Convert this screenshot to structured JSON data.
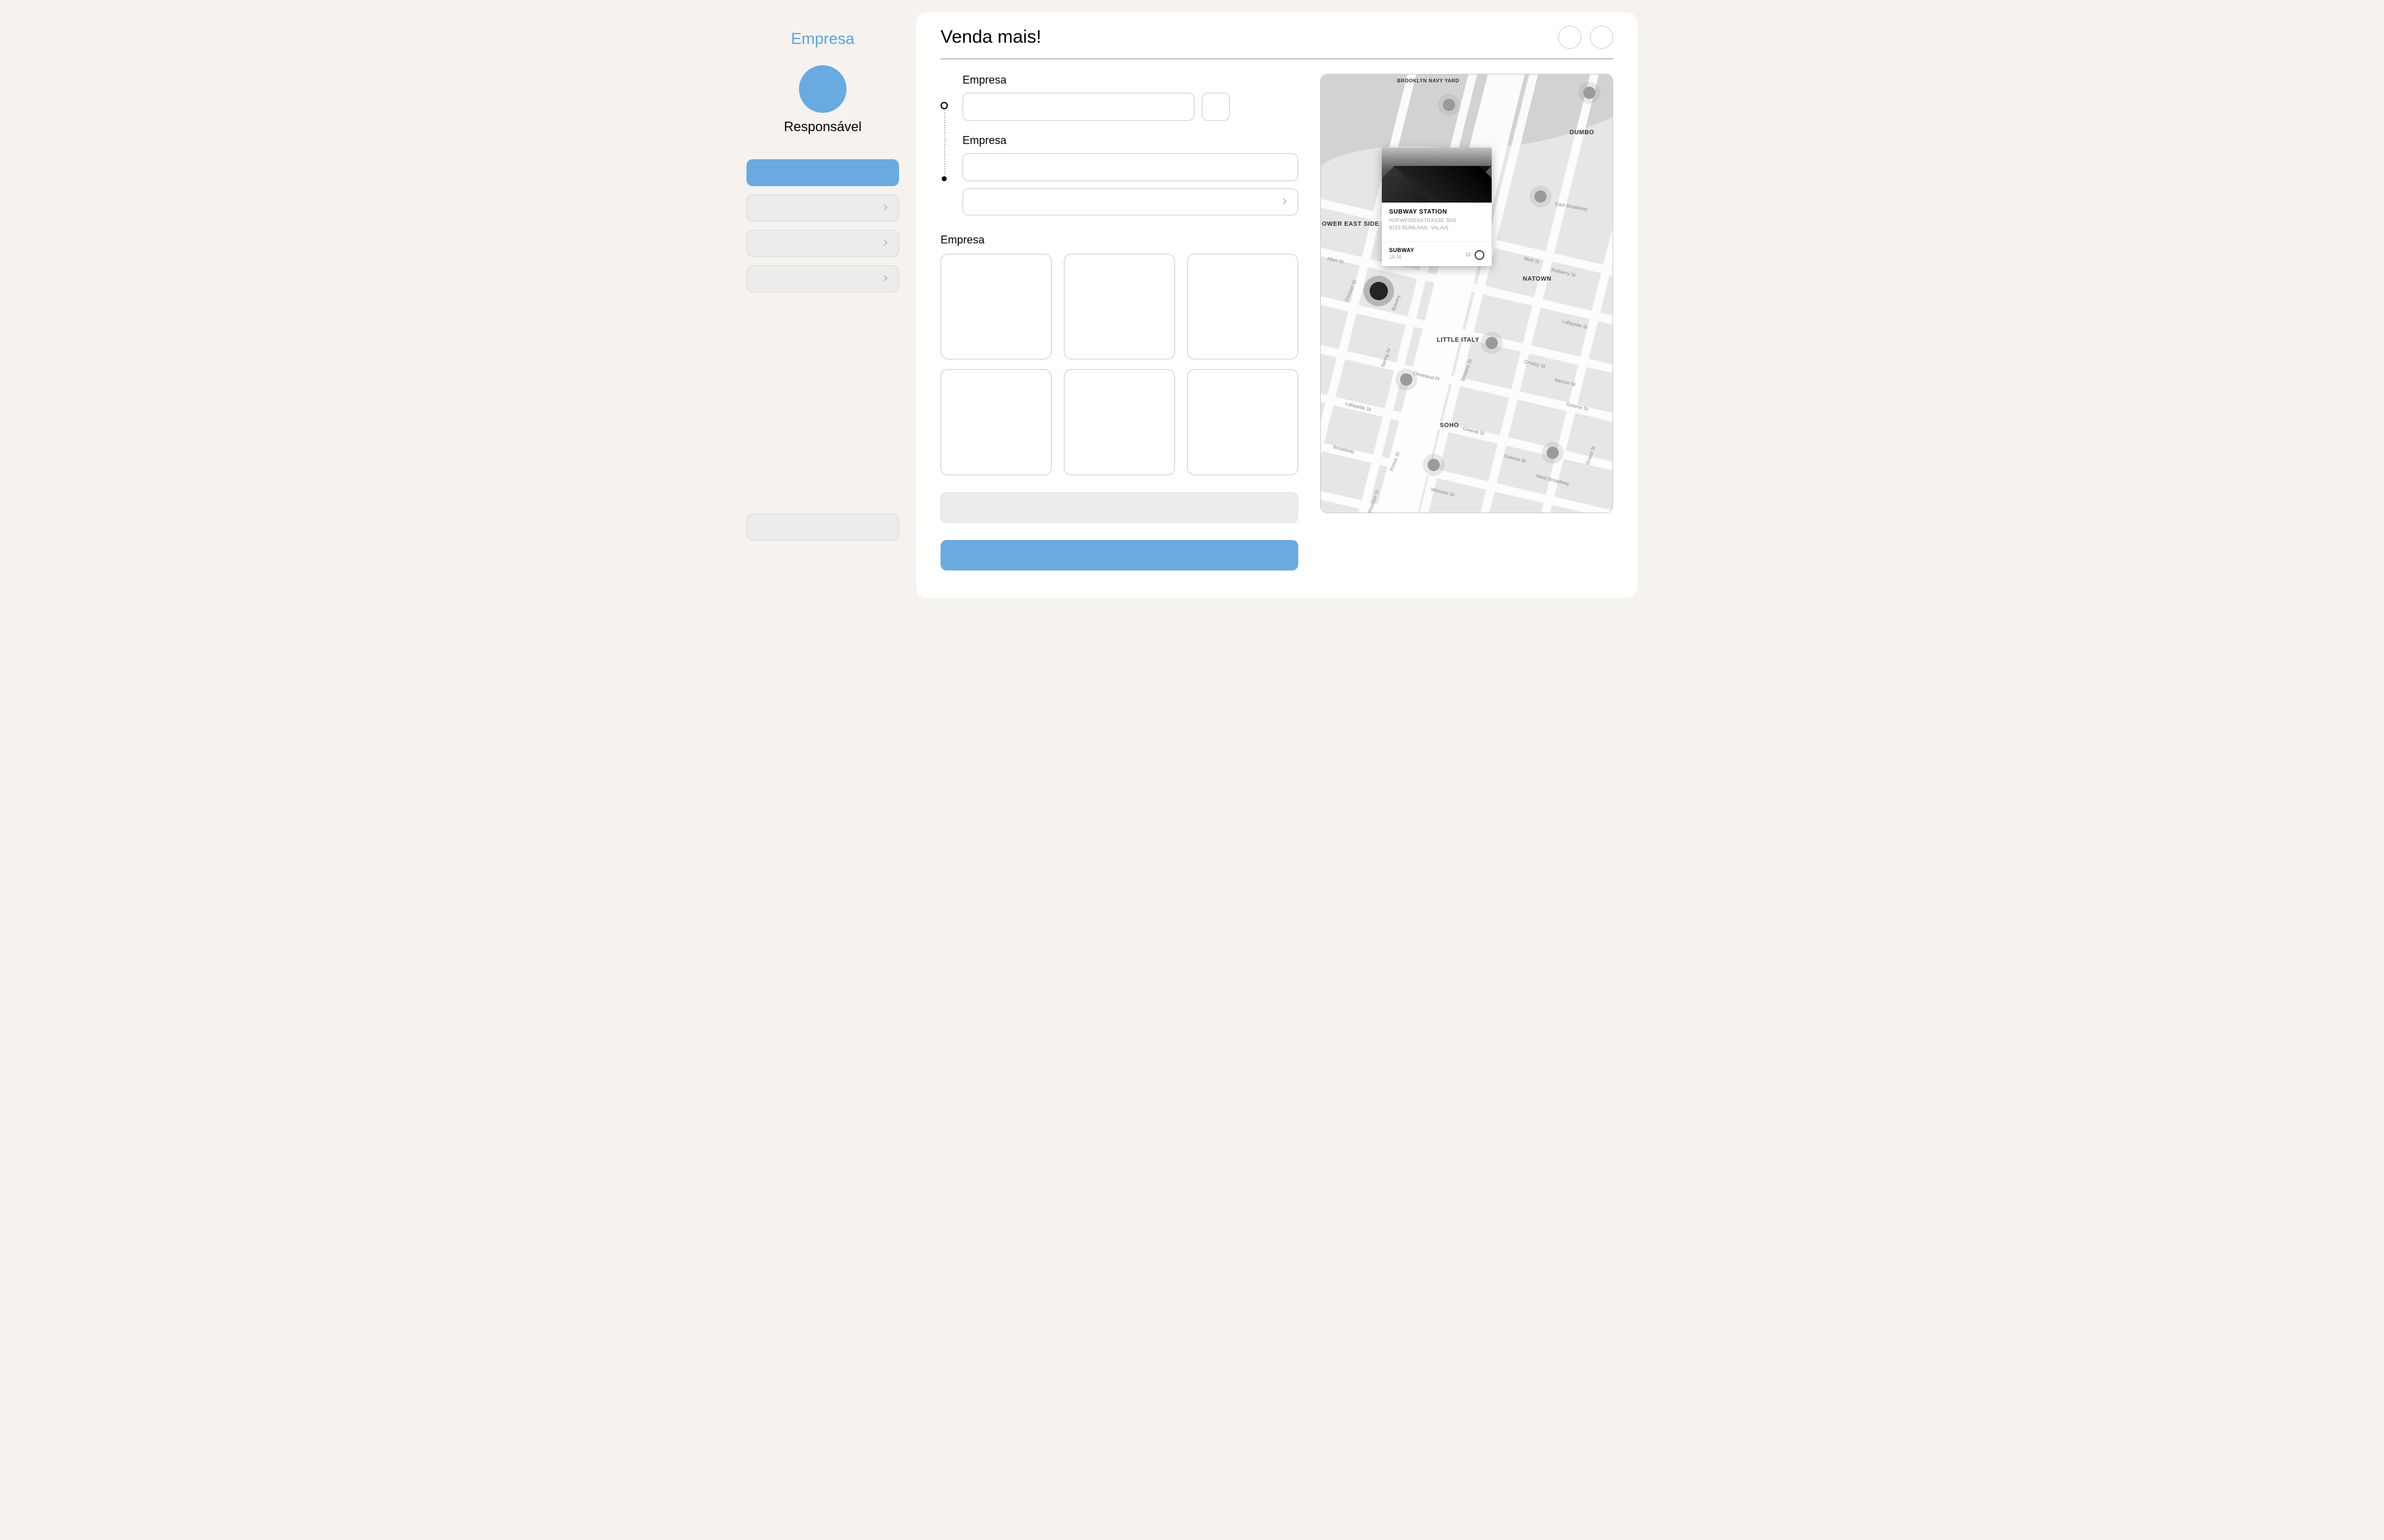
{
  "sidebar": {
    "title": "Empresa",
    "avatar_label": "Responsável",
    "primary_label": "",
    "nav_items": [
      {
        "label": ""
      },
      {
        "label": ""
      },
      {
        "label": ""
      }
    ],
    "bottom_label": ""
  },
  "main": {
    "title": "Venda mais!",
    "form_section1_label": "Empresa",
    "form_section2_label": "Empresa",
    "form_section3_label": "Empresa",
    "input1_value": "",
    "input2_value": "",
    "select_value": "",
    "grey_bar_label": "",
    "submit_label": ""
  },
  "map": {
    "districts": {
      "brooklyn_navy_yard": "BROOKLYN NAVY YARD",
      "dumbo": "DUMBO",
      "lower_east_side": "OWER EAST SIDE",
      "chinatown": "NATOWN",
      "little_italy": "LITTLE ITALY",
      "soho": "SOHO"
    },
    "streets": {
      "east_broadway": "East Broadway",
      "allen": "Allen St",
      "division": "Division St",
      "bowery": "Bowery",
      "spring": "Spring St",
      "broome": "Broome St",
      "cleveland": "Cleveland Pl",
      "mulberry": "Mulberry St",
      "mott": "Mott St",
      "lafayette1": "Lafayette St",
      "lafayette2": "Lafayette St",
      "crosby": "Crosby St",
      "mercer": "Mercer St",
      "greene1": "Greene St",
      "greene2": "Greene St",
      "greene3": "Greene St",
      "prince": "Prince St",
      "wooster": "Wooster St",
      "broadway": "Broadway",
      "w_broadway": "West Broadway",
      "w_houston": "W Houston St",
      "grand": "Grand St"
    },
    "poi": {
      "title": "SUBWAY STATION",
      "address_line1": "HOFWEISENSTRASSE 30/5",
      "address_line2": "8153 RÜMLAND, VALAIS",
      "category": "SUBWAY",
      "hours": "18-36",
      "count": "12"
    }
  },
  "colors": {
    "accent": "#69abe0",
    "bg": "#f6f2ee",
    "border": "#c9c9c9"
  }
}
